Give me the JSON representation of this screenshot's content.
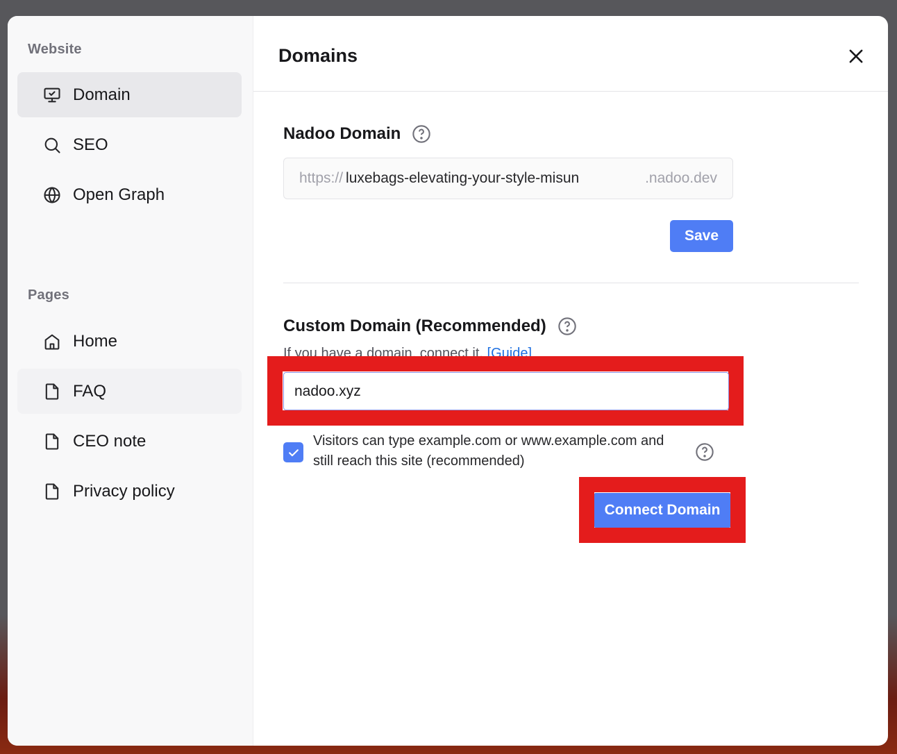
{
  "sidebar": {
    "website_label": "Website",
    "website_items": [
      {
        "label": "Domain",
        "icon": "monitor-check-icon"
      },
      {
        "label": "SEO",
        "icon": "search-icon"
      },
      {
        "label": "Open Graph",
        "icon": "globe-icon"
      }
    ],
    "pages_label": "Pages",
    "page_items": [
      {
        "label": "Home",
        "icon": "home-icon"
      },
      {
        "label": "FAQ",
        "icon": "file-icon"
      },
      {
        "label": "CEO note",
        "icon": "file-icon"
      },
      {
        "label": "Privacy policy",
        "icon": "file-icon"
      }
    ]
  },
  "header": {
    "title": "Domains"
  },
  "nadoo_domain": {
    "title": "Nadoo Domain",
    "prefix": "https://",
    "value": "luxebags-elevating-your-style-misun",
    "suffix": ".nadoo.dev",
    "save_label": "Save"
  },
  "custom_domain": {
    "title": "Custom Domain (Recommended)",
    "subtext": "If you have a domain, connect it.",
    "guide_link": "[Guide]",
    "input_value": "nadoo.xyz",
    "checkbox_checked": true,
    "checkbox_label": "Visitors can type example.com or www.example.com and still reach this site (recommended)",
    "connect_label": "Connect Domain"
  },
  "colors": {
    "accent": "#4f7df5",
    "highlight": "#e41c1c"
  }
}
